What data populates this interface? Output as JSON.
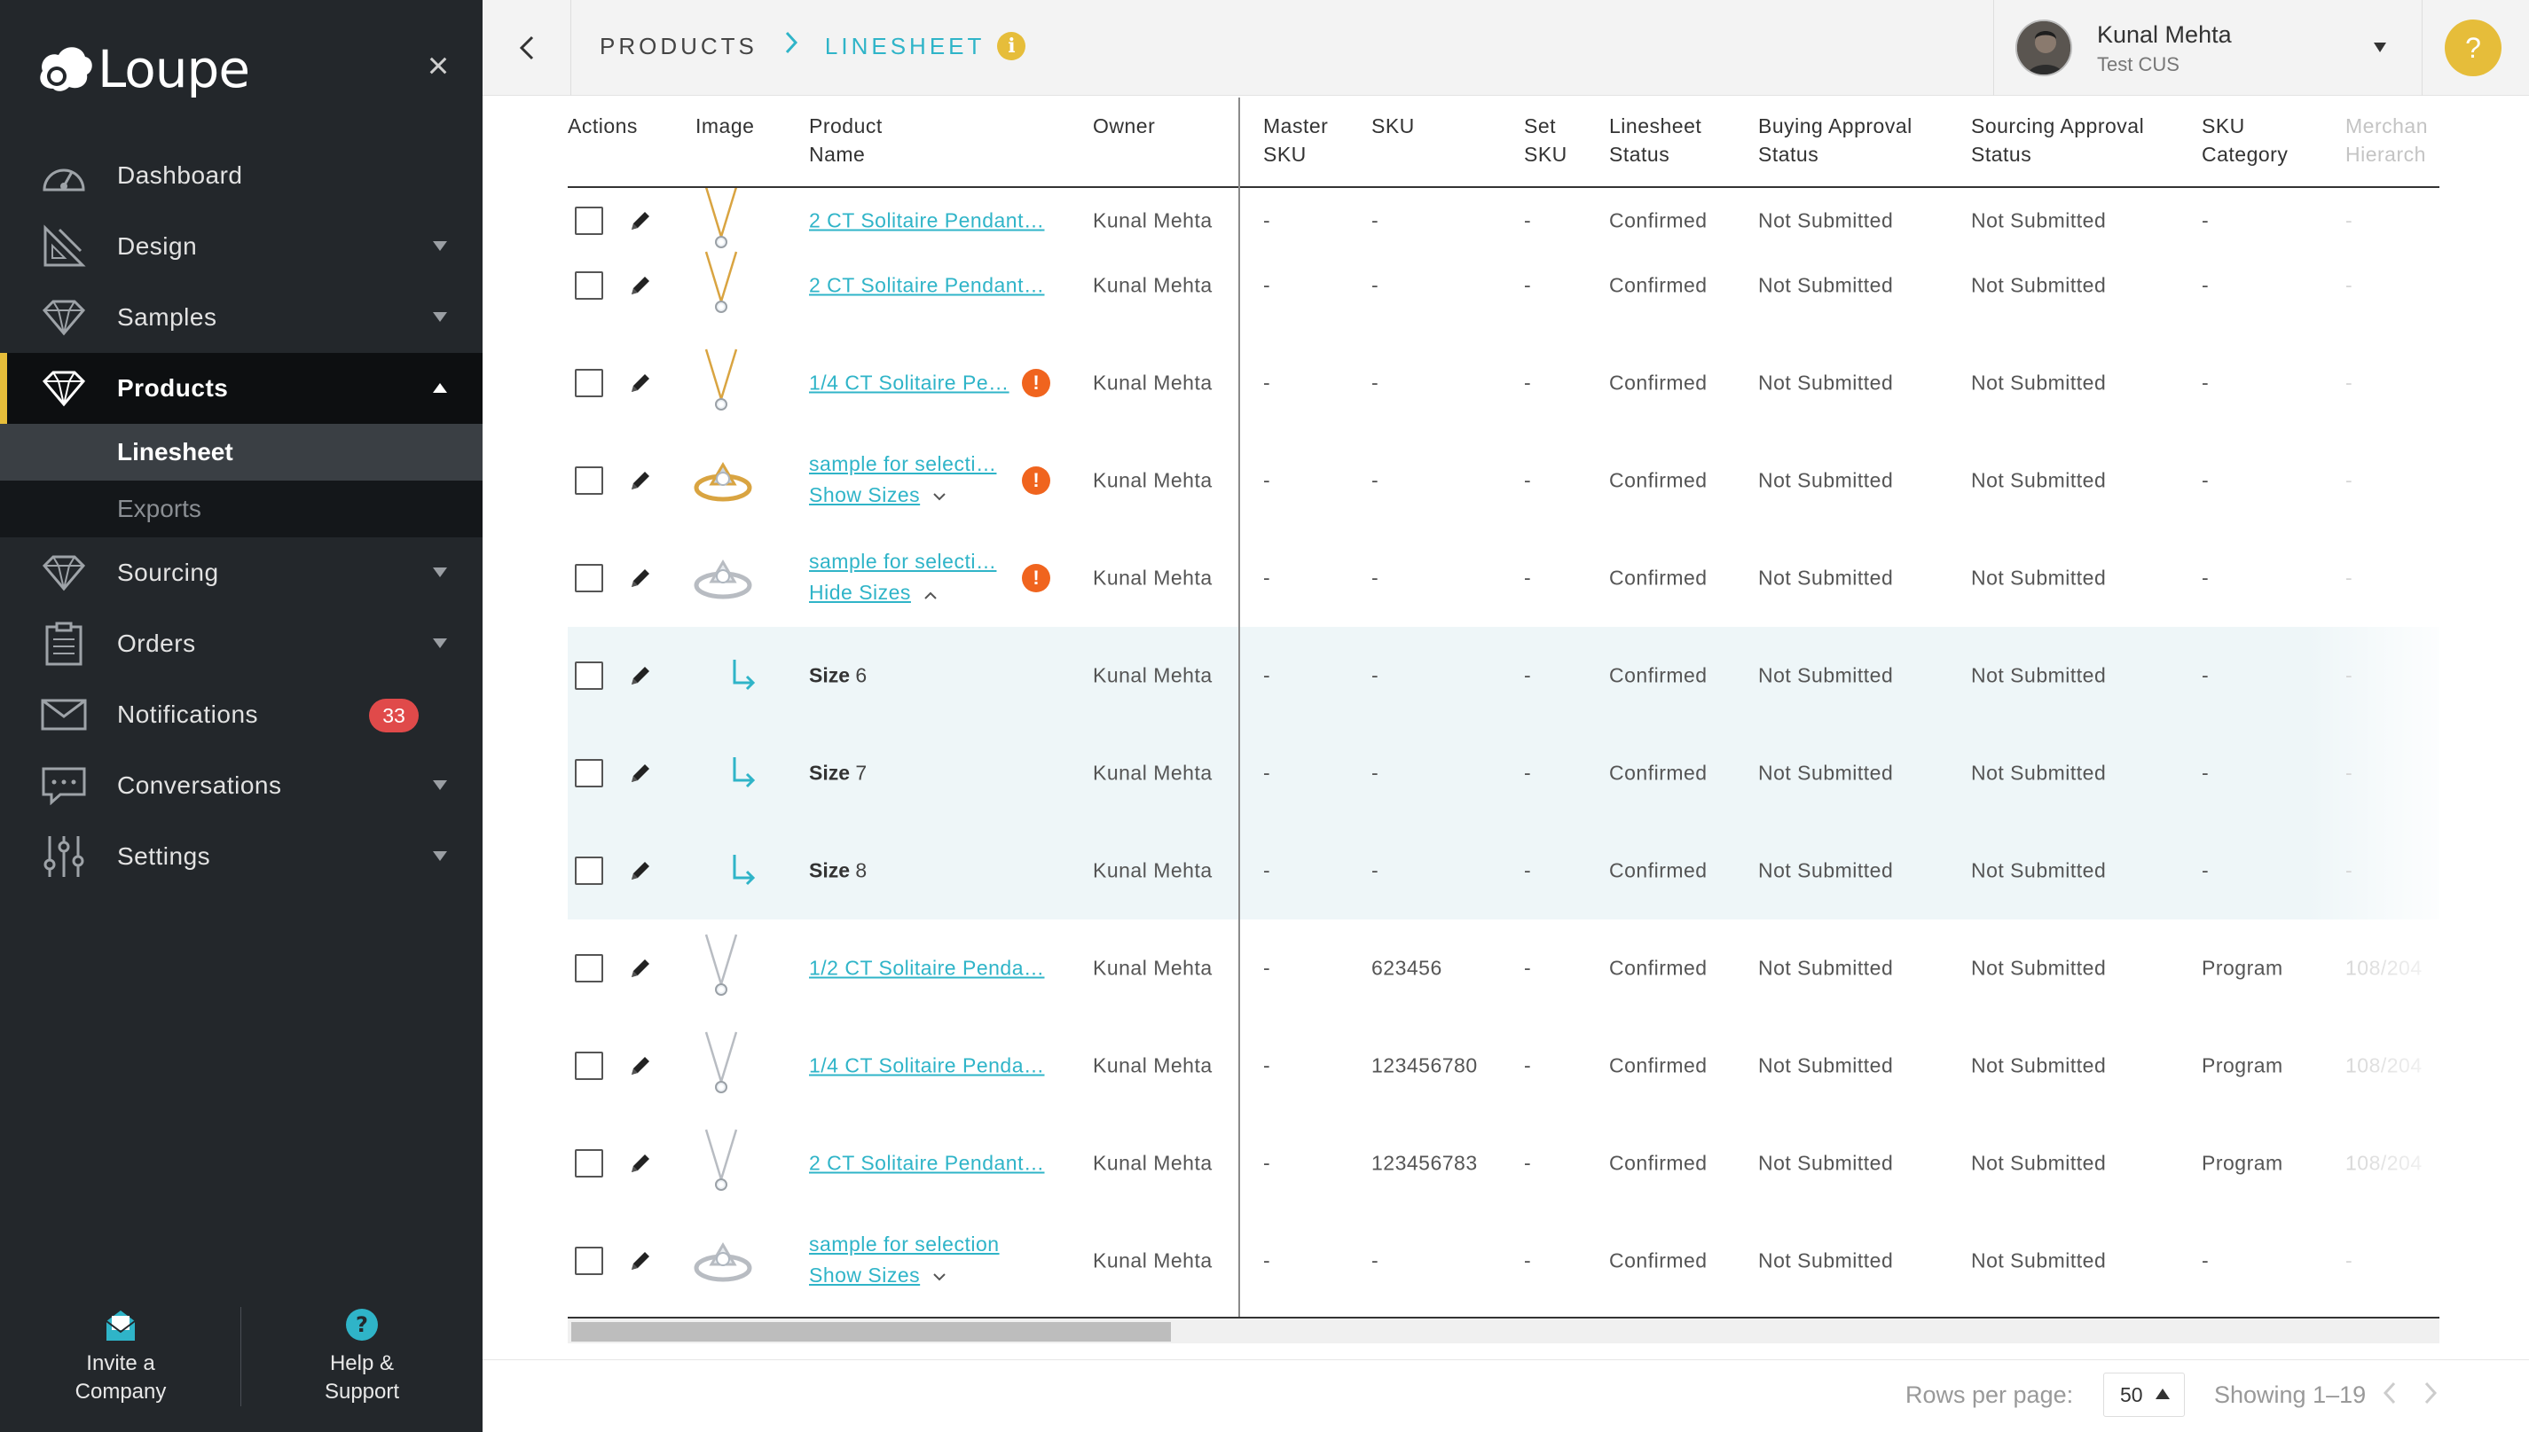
{
  "app": {
    "logo_text": "Loupe",
    "accent": "#e6bd3a",
    "link_color": "#2fb4c8",
    "badge_color": "#e04a4a",
    "warning_color": "#f0641e"
  },
  "sidebar": {
    "nav": [
      {
        "label": "Dashboard",
        "icon": "dashboard-gauge-icon"
      },
      {
        "label": "Design",
        "icon": "design-pencil-ruler-icon"
      },
      {
        "label": "Samples",
        "icon": "samples-diamond-icon"
      },
      {
        "label": "Products",
        "icon": "products-diamond-icon"
      },
      {
        "label": "Sourcing",
        "icon": "sourcing-diamond-icon"
      },
      {
        "label": "Orders",
        "icon": "orders-clipboard-icon"
      },
      {
        "label": "Notifications",
        "icon": "envelope-icon",
        "badge": "33"
      },
      {
        "label": "Conversations",
        "icon": "chat-bubble-icon"
      },
      {
        "label": "Settings",
        "icon": "sliders-icon"
      }
    ],
    "sub_items": [
      "Linesheet",
      "Exports"
    ],
    "invite": "Invite a Company",
    "help": "Help & Support"
  },
  "header": {
    "crumb_1": "PRODUCTS",
    "crumb_2": "LINESHEET",
    "info": "i",
    "user_name": "Kunal Mehta",
    "user_org": "Test CUS",
    "help": "?"
  },
  "table": {
    "headers": [
      "Actions",
      "Image",
      "Product Name",
      "Owner",
      "Master SKU",
      "SKU",
      "Set SKU",
      "Linesheet Status",
      "Buying Approval Status",
      "Sourcing Approval Status",
      "SKU Category",
      "Merchant Hierarchy"
    ],
    "header_lines": [
      [
        "Actions",
        ""
      ],
      [
        "Image",
        ""
      ],
      [
        "Product",
        "Name"
      ],
      [
        "Owner",
        ""
      ],
      [
        "Master",
        "SKU"
      ],
      [
        "SKU",
        ""
      ],
      [
        "Set",
        "SKU"
      ],
      [
        "Linesheet",
        "Status"
      ],
      [
        "Buying Approval",
        "Status"
      ],
      [
        "Sourcing Approval",
        "Status"
      ],
      [
        "SKU",
        "Category"
      ],
      [
        "Merchan",
        "Hierarch"
      ]
    ],
    "rows": [
      {
        "name": "2 CT Solitaire Pendant…",
        "owner": "Kunal Mehta",
        "master_sku": "-",
        "sku": "-",
        "set_sku": "-",
        "linesheet": "Confirmed",
        "buying": "Not Submitted",
        "sourcing": "Not Submitted",
        "category": "-",
        "merch": "-"
      },
      {
        "name": "2 CT Solitaire Pendant…",
        "owner": "Kunal Mehta",
        "master_sku": "-",
        "sku": "-",
        "set_sku": "-",
        "linesheet": "Confirmed",
        "buying": "Not Submitted",
        "sourcing": "Not Submitted",
        "category": "-",
        "merch": "-"
      },
      {
        "name": "1/4 CT Solitaire Pe…",
        "owner": "Kunal Mehta",
        "master_sku": "-",
        "sku": "-",
        "set_sku": "-",
        "linesheet": "Confirmed",
        "buying": "Not Submitted",
        "sourcing": "Not Submitted",
        "category": "-",
        "merch": "-",
        "warning": "!"
      },
      {
        "name": "sample for selecti…",
        "toggle": "Show Sizes",
        "owner": "Kunal Mehta",
        "master_sku": "-",
        "sku": "-",
        "set_sku": "-",
        "linesheet": "Confirmed",
        "buying": "Not Submitted",
        "sourcing": "Not Submitted",
        "category": "-",
        "merch": "-",
        "warning": "!"
      },
      {
        "name": "sample for selecti…",
        "toggle": "Hide Sizes",
        "owner": "Kunal Mehta",
        "master_sku": "-",
        "sku": "-",
        "set_sku": "-",
        "linesheet": "Confirmed",
        "buying": "Not Submitted",
        "sourcing": "Not Submitted",
        "category": "-",
        "merch": "-",
        "warning": "!"
      },
      {
        "size_word": "Size",
        "size_val": "6",
        "owner": "Kunal Mehta",
        "master_sku": "-",
        "sku": "-",
        "set_sku": "-",
        "linesheet": "Confirmed",
        "buying": "Not Submitted",
        "sourcing": "Not Submitted",
        "category": "-",
        "merch": "-"
      },
      {
        "size_word": "Size",
        "size_val": "7",
        "owner": "Kunal Mehta",
        "master_sku": "-",
        "sku": "-",
        "set_sku": "-",
        "linesheet": "Confirmed",
        "buying": "Not Submitted",
        "sourcing": "Not Submitted",
        "category": "-",
        "merch": "-"
      },
      {
        "size_word": "Size",
        "size_val": "8",
        "owner": "Kunal Mehta",
        "master_sku": "-",
        "sku": "-",
        "set_sku": "-",
        "linesheet": "Confirmed",
        "buying": "Not Submitted",
        "sourcing": "Not Submitted",
        "category": "-",
        "merch": "-"
      },
      {
        "name": "1/2 CT Solitaire Penda…",
        "owner": "Kunal Mehta",
        "master_sku": "-",
        "sku": "623456",
        "set_sku": "-",
        "linesheet": "Confirmed",
        "buying": "Not Submitted",
        "sourcing": "Not Submitted",
        "category": "Program",
        "merch": "108/204"
      },
      {
        "name": "1/4 CT Solitaire Penda…",
        "owner": "Kunal Mehta",
        "master_sku": "-",
        "sku": "123456780",
        "set_sku": "-",
        "linesheet": "Confirmed",
        "buying": "Not Submitted",
        "sourcing": "Not Submitted",
        "category": "Program",
        "merch": "108/204"
      },
      {
        "name": "2 CT Solitaire Pendant…",
        "owner": "Kunal Mehta",
        "master_sku": "-",
        "sku": "123456783",
        "set_sku": "-",
        "linesheet": "Confirmed",
        "buying": "Not Submitted",
        "sourcing": "Not Submitted",
        "category": "Program",
        "merch": "108/204"
      },
      {
        "name": "sample for selection",
        "toggle": "Show Sizes",
        "owner": "Kunal Mehta",
        "master_sku": "-",
        "sku": "-",
        "set_sku": "-",
        "linesheet": "Confirmed",
        "buying": "Not Submitted",
        "sourcing": "Not Submitted",
        "category": "-",
        "merch": "-"
      }
    ]
  },
  "footer": {
    "rows_label": "Rows per page:",
    "rows_value": "50",
    "showing": "Showing 1–19"
  }
}
